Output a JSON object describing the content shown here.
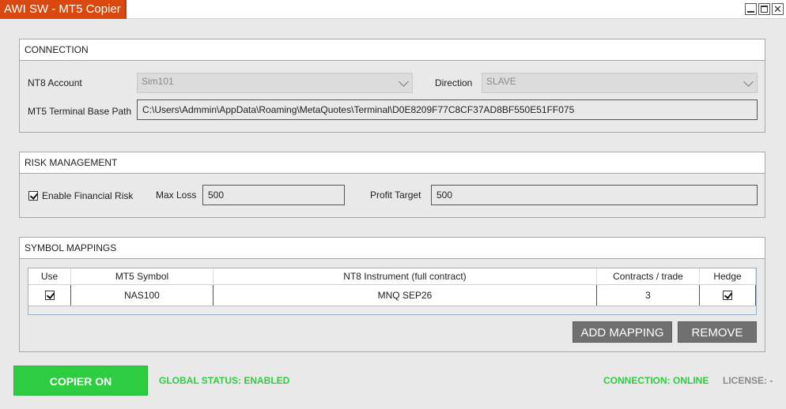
{
  "window": {
    "title": "AWI SW - MT5 Copier",
    "controls": {
      "minimize": "minimize-icon",
      "maximize": "maximize-icon",
      "close": "✕"
    }
  },
  "connection": {
    "header": "CONNECTION",
    "nt8_account_label": "NT8 Account",
    "nt8_account_value": "Sim101",
    "direction_label": "Direction",
    "direction_value": "SLAVE",
    "mt5_path_label": "MT5 Terminal Base Path",
    "mt5_path_value": "C:\\Users\\Admmin\\AppData\\Roaming\\MetaQuotes\\Terminal\\D0E8209F77C8CF37AD8BF550E51FF075"
  },
  "risk": {
    "header": "RISK MANAGEMENT",
    "enable_label": "Enable Financial Risk",
    "enable_checked": true,
    "max_loss_label": "Max Loss",
    "max_loss_value": "500",
    "profit_target_label": "Profit Target",
    "profit_target_value": "500"
  },
  "symbols": {
    "header": "SYMBOL MAPPINGS",
    "columns": [
      "Use",
      "MT5 Symbol",
      "NT8 Instrument (full contract)",
      "Contracts / trade",
      "Hedge"
    ],
    "rows": [
      {
        "use": true,
        "mt5_symbol": "NAS100",
        "nt8_instrument": "MNQ SEP26",
        "contracts": "3",
        "hedge": true
      }
    ],
    "add_button": "ADD MAPPING",
    "remove_button": "REMOVE"
  },
  "footer": {
    "copier_button": "COPIER ON",
    "global_status": "GLOBAL STATUS: ENABLED",
    "connection_status": "CONNECTION: ONLINE",
    "license": "LICENSE: -"
  },
  "colors": {
    "title_accent": "#d9480f",
    "copier_on": "#2ecc40",
    "status_green": "#2ecc40",
    "license_gray": "#8a8a8a",
    "button_gray": "#707070"
  }
}
